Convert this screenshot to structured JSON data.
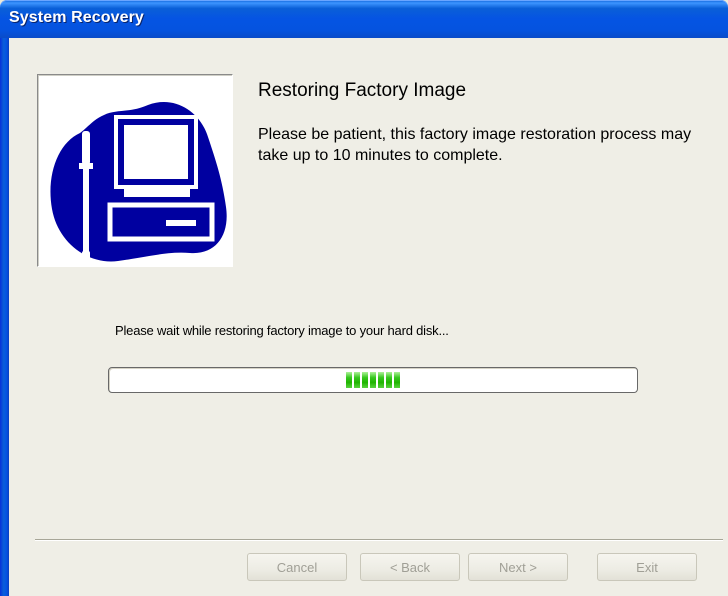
{
  "window": {
    "title": "System Recovery"
  },
  "header": {
    "title": "Restoring Factory Image",
    "description": "Please be patient, this factory image restoration process may take up to 10 minutes to complete."
  },
  "logo": {
    "icon": "computer-with-screwdriver-icon",
    "colors": {
      "primary": "#0000a0",
      "background": "#ffffff"
    }
  },
  "status": {
    "text": "Please wait while restoring factory image to your hard disk...",
    "progress_blocks_visible": 7,
    "progress_color": "#1fb400"
  },
  "buttons": {
    "cancel": "Cancel",
    "back": "< Back",
    "next": "Next >",
    "exit": "Exit"
  },
  "colors": {
    "titlebar": "#0554e3",
    "client_bg": "#efeee6"
  }
}
